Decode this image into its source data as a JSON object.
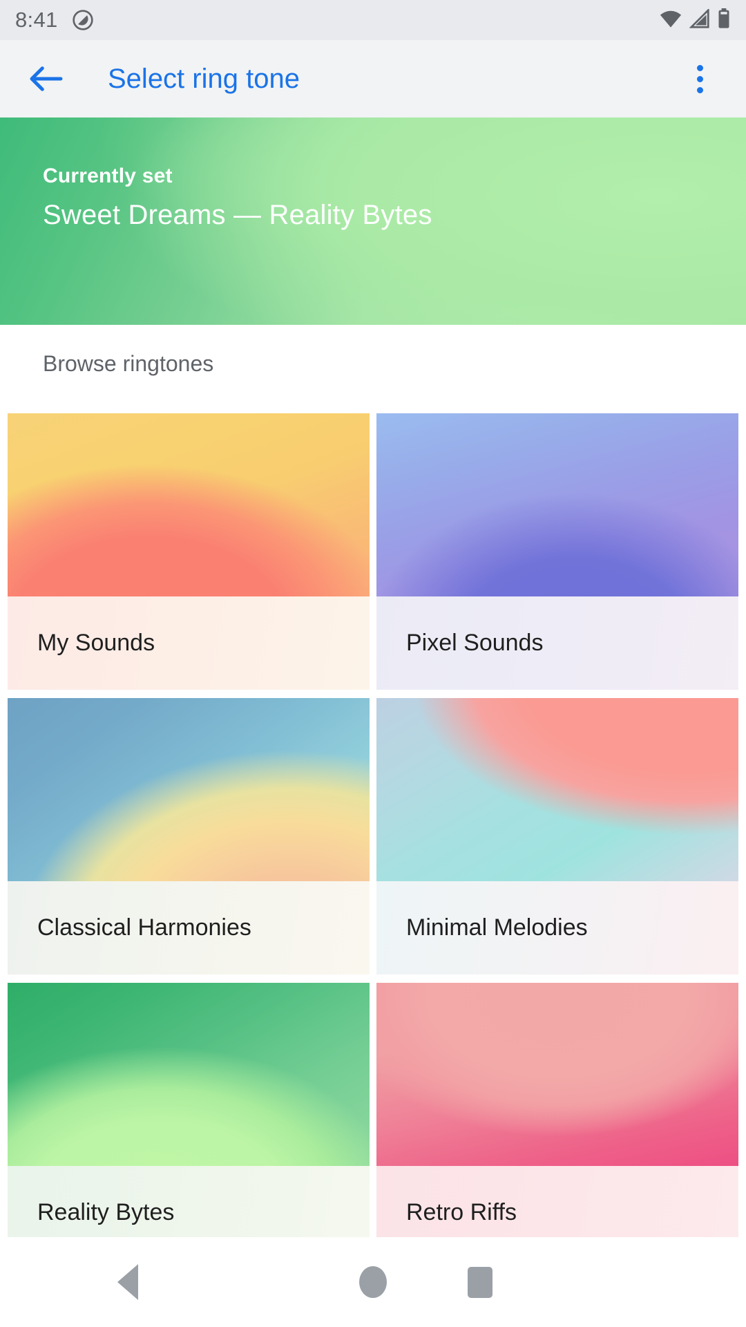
{
  "status_bar": {
    "time": "8:41",
    "notification_icon": "do-not-disturb-icon",
    "wifi_icon": "wifi-icon",
    "signal_icon": "cell-signal-icon",
    "battery_icon": "battery-icon"
  },
  "app_bar": {
    "back_icon": "back-arrow-icon",
    "title": "Select ring tone",
    "overflow_icon": "more-vert-icon",
    "accent_color": "#1a73e8"
  },
  "current_banner": {
    "eyebrow": "Currently set",
    "title": "Sweet Dreams — Reality Bytes"
  },
  "browse": {
    "header": "Browse ringtones",
    "cards": [
      {
        "label": "My Sounds",
        "art": "art-my-sounds",
        "label_bg": "lbl-my-sounds"
      },
      {
        "label": "Pixel Sounds",
        "art": "art-pixel-sounds",
        "label_bg": "lbl-pixel-sounds"
      },
      {
        "label": "Classical Harmonies",
        "art": "art-classical",
        "label_bg": "lbl-classical"
      },
      {
        "label": "Minimal Melodies",
        "art": "art-minimal",
        "label_bg": "lbl-minimal"
      },
      {
        "label": "Reality Bytes",
        "art": "art-reality",
        "label_bg": "lbl-reality"
      },
      {
        "label": "Retro Riffs",
        "art": "art-retro",
        "label_bg": "lbl-retro"
      }
    ]
  },
  "nav_bar": {
    "back_icon": "nav-back-triangle-icon",
    "home_icon": "nav-home-circle-icon",
    "recents_icon": "nav-recents-square-icon"
  }
}
